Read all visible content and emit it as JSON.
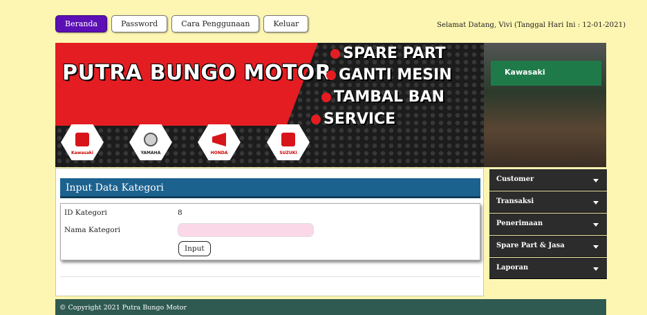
{
  "nav": {
    "items": [
      {
        "label": "Beranda",
        "active": true
      },
      {
        "label": "Password",
        "active": false
      },
      {
        "label": "Cara Penggunaan",
        "active": false
      },
      {
        "label": "Keluar",
        "active": false
      }
    ],
    "welcome": "Selamat Datang, Vivi (Tanggal Hari Ini : 12-01-2021)"
  },
  "banner": {
    "brand": "PUTRA BUNGO MOTOR",
    "services": [
      "SPARE PART",
      "GANTI MESIN",
      "TAMBAL BAN",
      "SERVICE"
    ],
    "shop_sign": "Kawasaki",
    "logos": [
      "Kawasaki",
      "YAMAHA",
      "HONDA",
      "SUZUKI"
    ]
  },
  "panel": {
    "title": "Input Data Kategori",
    "fields": {
      "id_label": "ID Kategori",
      "id_value": "8",
      "name_label": "Nama Kategori",
      "name_value": ""
    },
    "submit_label": "Input"
  },
  "menu": {
    "items": [
      "Customer",
      "Transaksi",
      "Penerimaan",
      "Spare Part & Jasa",
      "Laporan"
    ]
  },
  "footer": {
    "copyright": "© Copyright 2021 Putra Bungo Motor"
  },
  "colors": {
    "page_bg": "#fdf6b2",
    "active_nav": "#5b0fb4",
    "panel_header": "#1c628f",
    "menu_bg": "#2c2c2c",
    "footer_bg": "#2f5a52",
    "input_bg": "#fbd8e8"
  }
}
